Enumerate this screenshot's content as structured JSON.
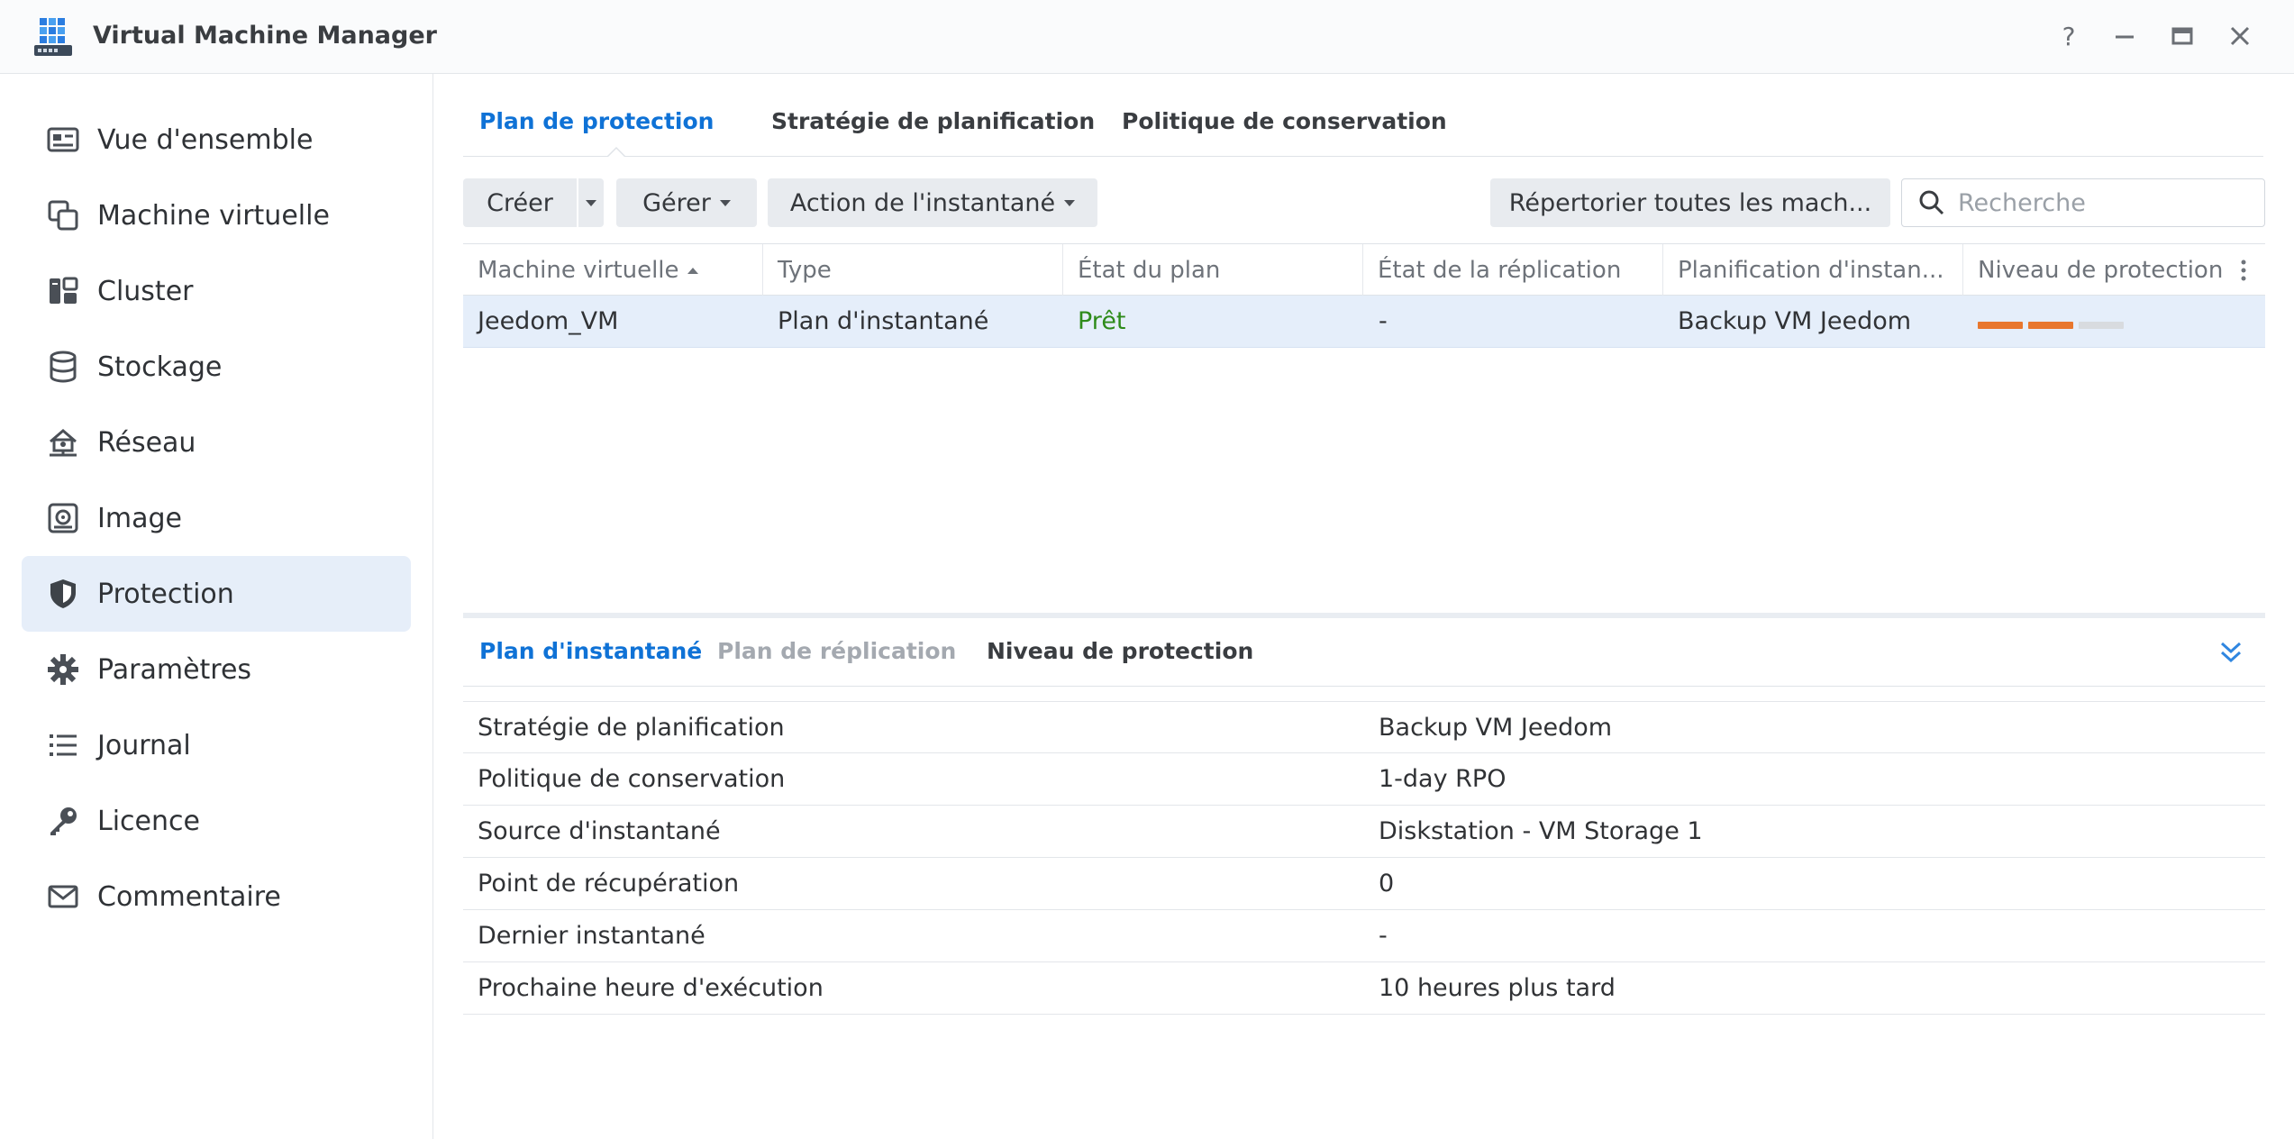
{
  "app": {
    "title": "Virtual Machine Manager"
  },
  "window_controls": {
    "help": "?",
    "minimize": "–",
    "maximize": "□",
    "close": "✕"
  },
  "sidebar": {
    "items": [
      {
        "label": "Vue d'ensemble",
        "icon": "overview-icon",
        "active": false
      },
      {
        "label": "Machine virtuelle",
        "icon": "virtual-machine-icon",
        "active": false
      },
      {
        "label": "Cluster",
        "icon": "cluster-icon",
        "active": false
      },
      {
        "label": "Stockage",
        "icon": "storage-icon",
        "active": false
      },
      {
        "label": "Réseau",
        "icon": "network-icon",
        "active": false
      },
      {
        "label": "Image",
        "icon": "image-icon",
        "active": false
      },
      {
        "label": "Protection",
        "icon": "shield-icon",
        "active": true
      },
      {
        "label": "Paramètres",
        "icon": "gear-icon",
        "active": false
      },
      {
        "label": "Journal",
        "icon": "log-list-icon",
        "active": false
      },
      {
        "label": "Licence",
        "icon": "key-icon",
        "active": false
      },
      {
        "label": "Commentaire",
        "icon": "mail-icon",
        "active": false
      }
    ]
  },
  "top_tabs": [
    {
      "label": "Plan de protection",
      "active": true
    },
    {
      "label": "Stratégie de planification",
      "active": false
    },
    {
      "label": "Politique de conservation",
      "active": false
    }
  ],
  "toolbar": {
    "create": "Créer",
    "manage": "Gérer",
    "snapshot_action": "Action de l'instantané",
    "list_all": "Répertorier toutes les mach...",
    "search_placeholder": "Recherche"
  },
  "grid": {
    "columns": [
      "Machine virtuelle",
      "Type",
      "État du plan",
      "État de la réplication",
      "Planification d'instan...",
      "Niveau de protection"
    ],
    "sort_column": "Machine virtuelle",
    "rows": [
      {
        "vm": "Jeedom_VM",
        "type": "Plan d'instantané",
        "plan_state": "Prêt",
        "replication_state": "-",
        "schedule": "Backup VM Jeedom",
        "protection_level": {
          "filled": 2,
          "total": 3
        }
      }
    ]
  },
  "bottom_tabs": [
    {
      "label": "Plan d'instantané",
      "state": "active"
    },
    {
      "label": "Plan de réplication",
      "state": "disabled"
    },
    {
      "label": "Niveau de protection",
      "state": "normal"
    }
  ],
  "details": [
    {
      "key": "Stratégie de planification",
      "value": "Backup VM Jeedom"
    },
    {
      "key": "Politique de conservation",
      "value": "1-day RPO"
    },
    {
      "key": "Source d'instantané",
      "value": "Diskstation - VM Storage 1"
    },
    {
      "key": "Point de récupération",
      "value": "0"
    },
    {
      "key": "Dernier instantané",
      "value": "-"
    },
    {
      "key": "Prochaine heure d'exécution",
      "value": "10 heures plus tard"
    }
  ],
  "colors": {
    "accent": "#0f72d6",
    "ready_green": "#2e8b1a",
    "protection_orange": "#e8772e",
    "protection_empty": "#d8dbdf",
    "selected_row": "#e5eefa"
  }
}
